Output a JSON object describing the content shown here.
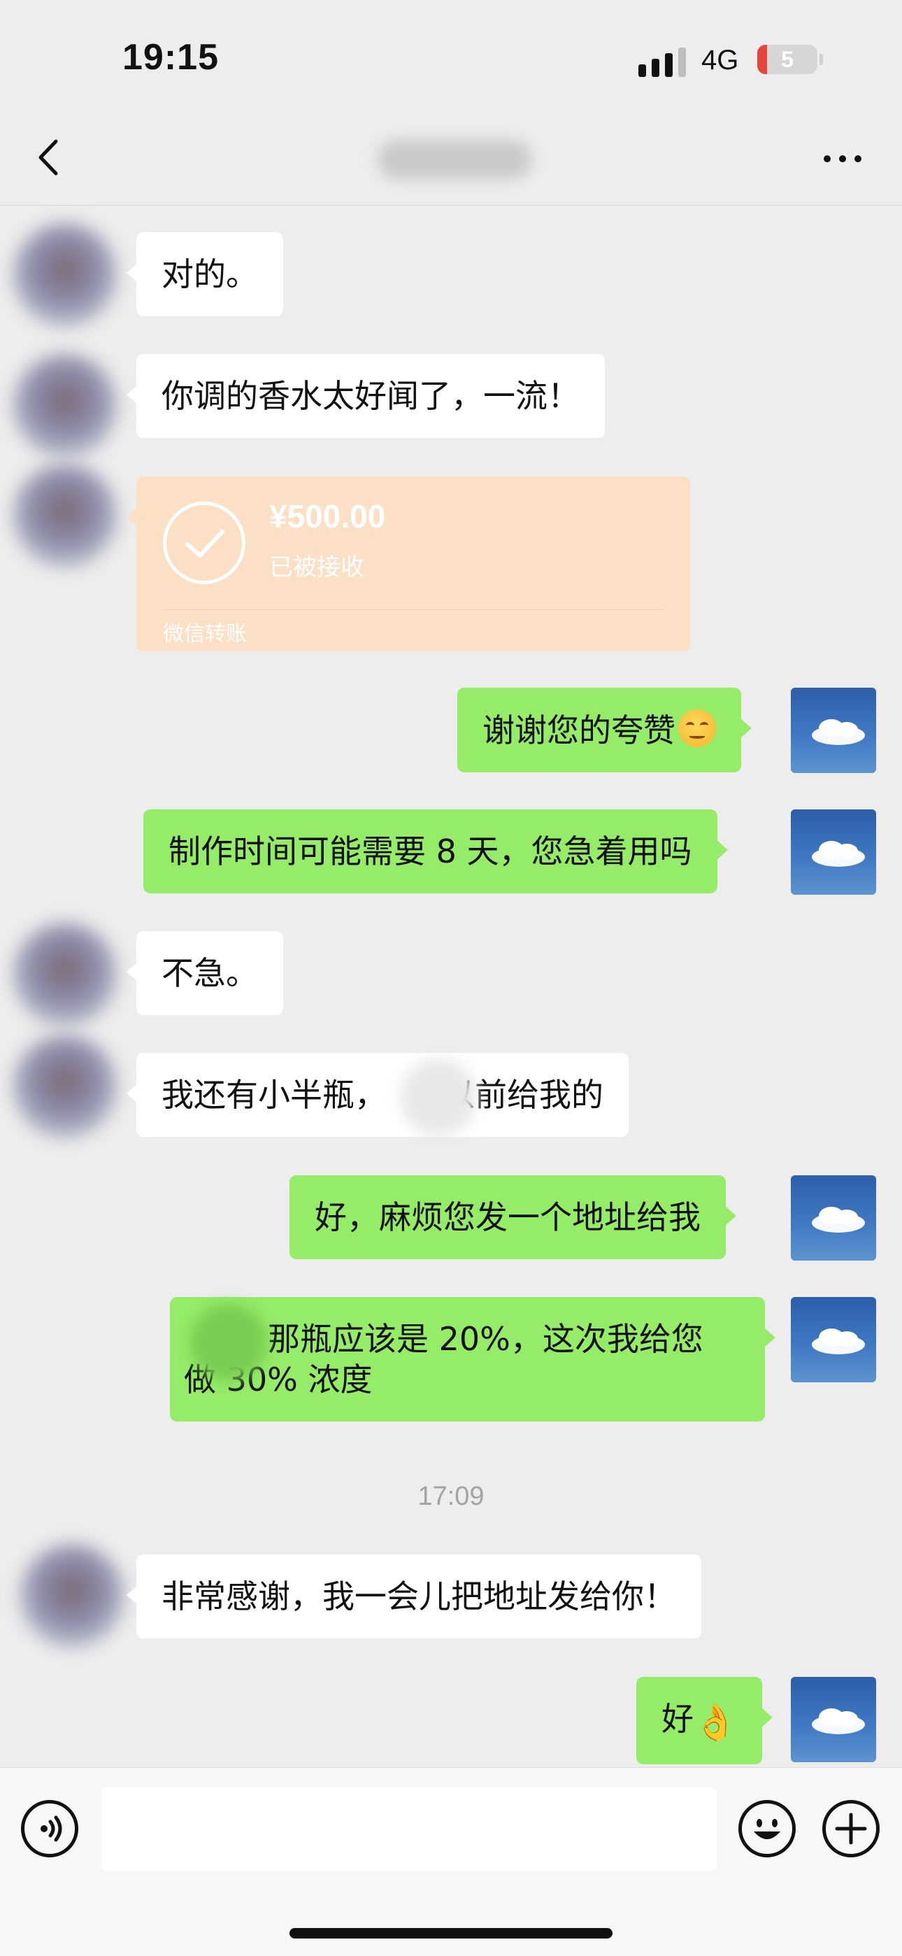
{
  "status_bar": {
    "time": "19:15",
    "network": "4G",
    "battery_level": "5",
    "battery_color": "#e5453a"
  },
  "nav": {
    "back_icon": "chevron-left-icon",
    "title": "",
    "more_icon": "more-dots-icon"
  },
  "colors": {
    "background": "#ededed",
    "bubble_in": "#ffffff",
    "bubble_out": "#95ec69",
    "transfer_card": "#fbe0c5"
  },
  "messages": [
    {
      "side": "in",
      "text": "对的。"
    },
    {
      "side": "in",
      "text": "你调的香水太好闻了，一流！"
    },
    {
      "side": "in",
      "type": "transfer",
      "amount": "¥500.00",
      "status": "已被接收",
      "label": "微信转账"
    },
    {
      "side": "out",
      "text": "谢谢您的夸赞",
      "emoji": "shy-smile-emoji"
    },
    {
      "side": "out",
      "text": "制作时间可能需要 8 天，您急着用吗"
    },
    {
      "side": "in",
      "text": "不急。"
    },
    {
      "side": "in",
      "text": "我还有小半瓶，",
      "text_after_blur": "以前给我的"
    },
    {
      "side": "out",
      "text": "好，麻烦您发一个地址给我"
    },
    {
      "side": "out",
      "line1": "那瓶应该是 20%，这次我给您",
      "line2": "做 30% 浓度"
    },
    {
      "side": "in",
      "text": "非常感谢，我一会儿把地址发给你！"
    },
    {
      "side": "out",
      "text": "好",
      "emoji": "ok-hand-emoji"
    }
  ],
  "time_divider": "17:09",
  "input_bar": {
    "voice_icon": "voice-icon",
    "input_value": "",
    "emoji_icon": "emoji-icon",
    "plus_icon": "plus-icon"
  }
}
